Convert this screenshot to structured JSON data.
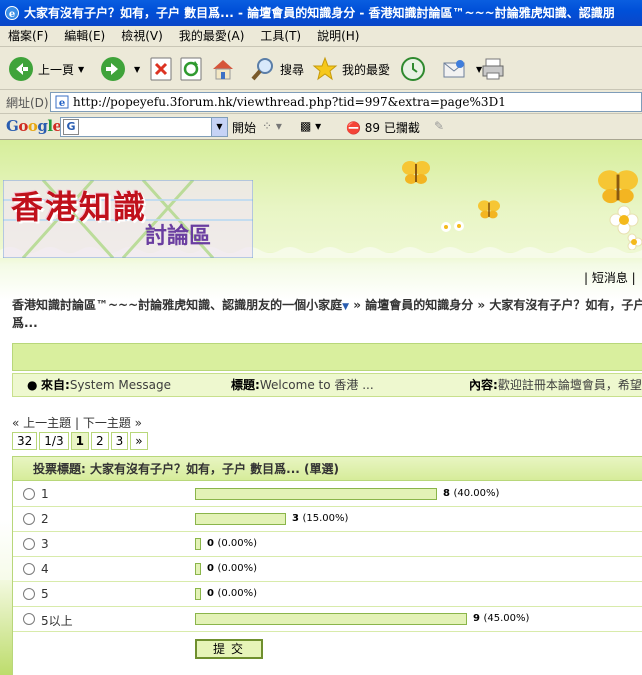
{
  "window": {
    "title": "大家有沒有子户？如有，子户 數目爲... - 論壇會員的知識身分 - 香港知識討論區™~~~討論雅虎知識、認識朋"
  },
  "menu": [
    "檔案(F)",
    "編輯(E)",
    "檢視(V)",
    "我的最愛(A)",
    "工具(T)",
    "說明(H)"
  ],
  "toolbar": {
    "back_label": "上一頁",
    "search_label": "搜尋",
    "favorites_label": "我的最愛"
  },
  "address": {
    "label": "網址(D)",
    "url": "http://popeyefu.3forum.hk/viewthread.php?tid=997&extra=page%3D1"
  },
  "google_bar": {
    "logo": "Google",
    "go_label": "開始",
    "blocked_label": "89 已攔截"
  },
  "page": {
    "logo_line1": "香港知識",
    "logo_line2": "討論區",
    "short_message": "| 短消息 |",
    "breadcrumb": {
      "forum": "香港知識討論區™~~~討論雅虎知識、認識朋友的一個小家庭",
      "section": " » 論壇會員的知識身分 »",
      "thread": " 大家有沒有子户？如有，子户 數目",
      "thread_cont": "爲..."
    },
    "notice": {
      "from_label": "來自:",
      "from_value": "System Message",
      "title_label": "標題:",
      "title_value": "Welcome to 香港 ...",
      "content_label": "內容:",
      "content_value": "歡迎註冊本論壇會員，希望"
    },
    "prev_next": "« 上一主題 | 下一主題 »",
    "pager": [
      "32",
      "1/3",
      "1",
      "2",
      "3",
      "»"
    ],
    "pager_current": "1",
    "poll": {
      "title": "投票標題: 大家有沒有子户？如有，子户 數目爲... (單選)",
      "options": [
        {
          "label": "1",
          "count": "8",
          "pct_text": "(40.00%)",
          "percent": 40
        },
        {
          "label": "2",
          "count": "3",
          "pct_text": "(15.00%)",
          "percent": 15
        },
        {
          "label": "3",
          "count": "0",
          "pct_text": "(0.00%)",
          "percent": 0
        },
        {
          "label": "4",
          "count": "0",
          "pct_text": "(0.00%)",
          "percent": 0
        },
        {
          "label": "5",
          "count": "0",
          "pct_text": "(0.00%)",
          "percent": 0
        },
        {
          "label": "5以上",
          "count": "9",
          "pct_text": "(45.00%)",
          "percent": 45
        }
      ],
      "submit_label": "提交"
    }
  },
  "colors": {
    "titlebar": "#0050d8",
    "page_green": "#d9ef9e",
    "bar_fill": "#e3f2b6",
    "bar_border": "#8ab54a"
  }
}
